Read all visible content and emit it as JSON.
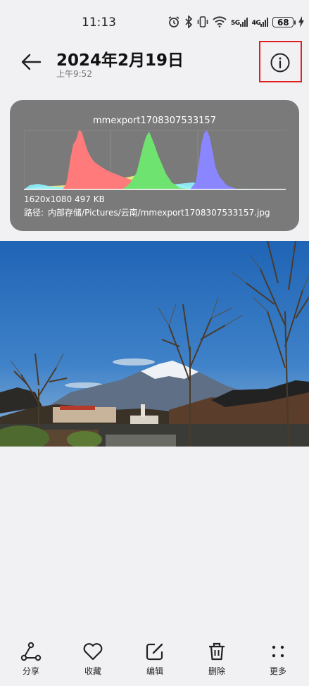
{
  "status_bar": {
    "time": "11:13",
    "battery": "68",
    "network_labels": [
      "5G",
      "4G"
    ]
  },
  "header": {
    "title": "2024年2月19日",
    "subtitle": "上午9:52"
  },
  "info_card": {
    "filename": "mmexport1708307533157",
    "resolution_size": "1620x1080  497 KB",
    "path_label": "路径:",
    "path": "内部存储/Pictures/云南/mmexport1708307533157.jpg",
    "histogram_colors": {
      "red": "#ff7b7b",
      "green": "#6fe36f",
      "blue": "#8a86ff",
      "yellow": "#f5ef7a",
      "cyan": "#8ef2ff"
    }
  },
  "toolbar": {
    "items": [
      {
        "label": "分享",
        "icon": "share-icon"
      },
      {
        "label": "收藏",
        "icon": "heart-icon"
      },
      {
        "label": "编辑",
        "icon": "edit-icon"
      },
      {
        "label": "删除",
        "icon": "trash-icon"
      },
      {
        "label": "更多",
        "icon": "more-icon"
      }
    ]
  }
}
